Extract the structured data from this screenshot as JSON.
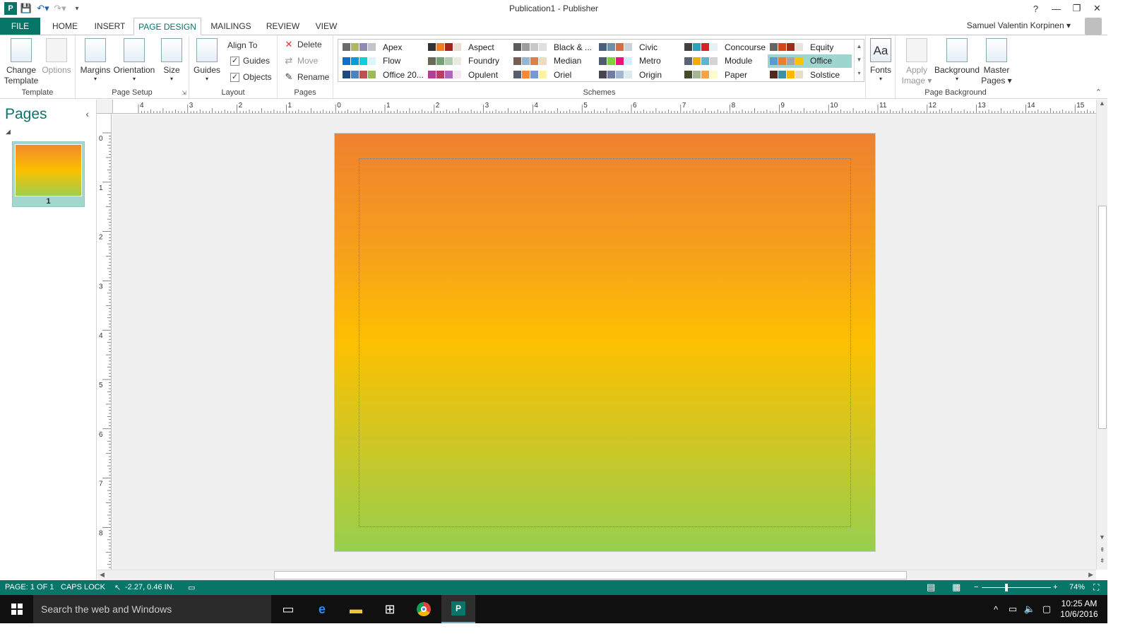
{
  "title_bar": {
    "title": "Publication1 - Publisher",
    "help": "?",
    "minimize": "—",
    "restore": "❐",
    "close": "✕"
  },
  "tabs": {
    "file": "FILE",
    "home": "HOME",
    "insert": "INSERT",
    "page_design": "PAGE DESIGN",
    "mailings": "MAILINGS",
    "review": "REVIEW",
    "view": "VIEW",
    "active": "PAGE DESIGN"
  },
  "user": {
    "name": "Samuel Valentin Korpinen ▾"
  },
  "ribbon": {
    "template": {
      "change_template_1": "Change",
      "change_template_2": "Template",
      "options": "Options",
      "label": "Template"
    },
    "page_setup": {
      "margins": "Margins",
      "orientation": "Orientation",
      "size": "Size",
      "label": "Page Setup"
    },
    "layout": {
      "guides": "Guides",
      "align_to": "Align To",
      "guides_check": "Guides",
      "objects_check": "Objects",
      "label": "Layout"
    },
    "pages": {
      "delete": "Delete",
      "move": "Move",
      "rename": "Rename",
      "label": "Pages"
    },
    "schemes": {
      "label": "Schemes",
      "items": [
        {
          "name": "Apex",
          "colors": [
            "#6b6b6b",
            "#b0b56a",
            "#8e8cb5",
            "#c3c3cc"
          ]
        },
        {
          "name": "Aspect",
          "colors": [
            "#333333",
            "#ee7e22",
            "#a3231f",
            "#e8e0d4"
          ]
        },
        {
          "name": "Black & ...",
          "colors": [
            "#5c5c5c",
            "#9c9c9c",
            "#c8c8c8",
            "#e0e0e0"
          ]
        },
        {
          "name": "Civic",
          "colors": [
            "#4a5f79",
            "#6f8eaa",
            "#d26f47",
            "#c8d3d9"
          ]
        },
        {
          "name": "Concourse",
          "colors": [
            "#404040",
            "#2da2bf",
            "#da1f28",
            "#e6f1f5"
          ]
        },
        {
          "name": "Equity",
          "colors": [
            "#696464",
            "#d34817",
            "#9b2d1f",
            "#e9e5dc"
          ]
        },
        {
          "name": "Flow",
          "colors": [
            "#0f6fc6",
            "#009dd9",
            "#0bd0d9",
            "#dbf5f9"
          ]
        },
        {
          "name": "Foundry",
          "colors": [
            "#676a55",
            "#72a376",
            "#b0ccb0",
            "#eaebde"
          ]
        },
        {
          "name": "Median",
          "colors": [
            "#775f55",
            "#94b6d2",
            "#dd8047",
            "#ebddc3"
          ]
        },
        {
          "name": "Metro",
          "colors": [
            "#4e5b6f",
            "#7fd13b",
            "#ea157a",
            "#d6ecff"
          ]
        },
        {
          "name": "Module",
          "colors": [
            "#5a6378",
            "#f0ad00",
            "#60b5cc",
            "#d4d4d4"
          ]
        },
        {
          "name": "Office",
          "colors": [
            "#5b9bd5",
            "#ed7d31",
            "#a5a5a5",
            "#ffc000"
          ]
        },
        {
          "name": "Office 20...",
          "colors": [
            "#1f497d",
            "#4f81bd",
            "#c0504d",
            "#9bbb59"
          ]
        },
        {
          "name": "Opulent",
          "colors": [
            "#b13f9a",
            "#b83d68",
            "#ac66bb",
            "#f4e7ed"
          ]
        },
        {
          "name": "Oriel",
          "colors": [
            "#575f6d",
            "#fe8637",
            "#7598d9",
            "#fff39d"
          ]
        },
        {
          "name": "Origin",
          "colors": [
            "#464653",
            "#727ca3",
            "#9fb8cd",
            "#dde9ec"
          ]
        },
        {
          "name": "Paper",
          "colors": [
            "#444d26",
            "#a5b592",
            "#f3a447",
            "#fefac9"
          ]
        },
        {
          "name": "Solstice",
          "colors": [
            "#4f271c",
            "#3891a7",
            "#feb80a",
            "#e7dec9"
          ]
        }
      ],
      "selected": "Office"
    },
    "fonts": "Fonts",
    "page_background": {
      "apply_image_1": "Apply",
      "apply_image_2": "Image ▾",
      "background": "Background",
      "master_pages_1": "Master",
      "master_pages_2": "Pages ▾",
      "label": "Page Background"
    }
  },
  "pages_pane": {
    "title": "Pages",
    "collapse": "‹",
    "thumbnail_number": "1"
  },
  "rulers": {
    "horizontal_labels": [
      "4",
      "3",
      "2",
      "1",
      "0",
      "1",
      "2",
      "3",
      "4",
      "5",
      "6",
      "7",
      "8",
      "9",
      "10",
      "11",
      "12",
      "13",
      "14",
      "15"
    ],
    "vertical_labels": [
      "0",
      "1",
      "2",
      "3",
      "4",
      "5",
      "6",
      "7",
      "8"
    ]
  },
  "page": {
    "gradient": [
      "#ee812f",
      "#fdc000",
      "#96cf4e"
    ]
  },
  "status_bar": {
    "page": "PAGE: 1 OF 1",
    "caps_lock": "CAPS LOCK",
    "position": "-2.27, 0.46 IN.",
    "zoom": "74%"
  },
  "taskbar": {
    "search_placeholder": "Search the web and Windows",
    "time": "10:25 AM",
    "date": "10/6/2016"
  },
  "colors": {
    "accent": "#077568",
    "selected_scheme": "#9fd5cf"
  }
}
